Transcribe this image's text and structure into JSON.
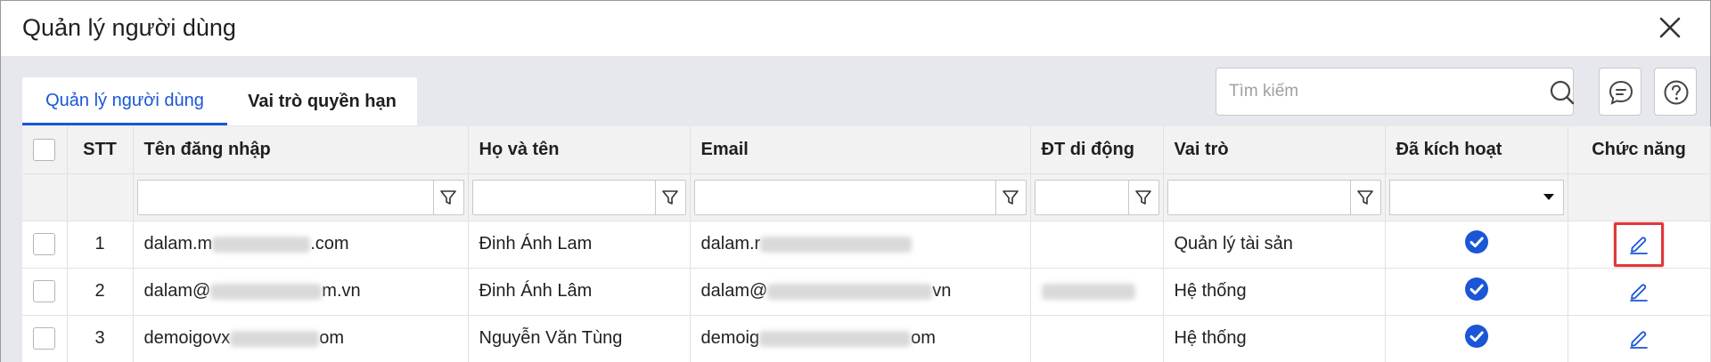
{
  "window": {
    "title": "Quản lý người dùng"
  },
  "tabs": [
    {
      "label": "Quản lý người dùng",
      "active": true
    },
    {
      "label": "Vai trò quyền hạn",
      "active": false
    }
  ],
  "search": {
    "placeholder": "Tìm kiếm"
  },
  "icons": {
    "search": "search-icon",
    "feedback": "chat-bubble-icon",
    "help": "help-circle-icon",
    "close": "close-icon",
    "filter": "filter-funnel-icon",
    "active": "check-circle-icon",
    "edit": "pencil-edit-icon"
  },
  "colors": {
    "accent": "#1a56d6",
    "check": "#1a56d6",
    "highlight": "#e0383b",
    "body_bg": "#e6e8ee"
  },
  "table": {
    "columns": [
      "STT",
      "Tên đăng nhập",
      "Họ và tên",
      "Email",
      "ĐT di động",
      "Vai trò",
      "Đã kích hoạt",
      "Chức năng"
    ],
    "rows": [
      {
        "stt": "1",
        "username_prefix": "dalam.m",
        "username_suffix": ".com",
        "fullname": "Đinh Ánh Lam",
        "email_prefix": "dalam.r",
        "email_suffix": "",
        "phone": "",
        "role": "Quản lý tài sản",
        "active": true
      },
      {
        "stt": "2",
        "username_prefix": "dalam@",
        "username_suffix": "m.vn",
        "fullname": "Đinh Ánh Lâm",
        "email_prefix": "dalam@",
        "email_suffix": "vn",
        "phone": "",
        "role": "Hệ thống",
        "active": true
      },
      {
        "stt": "3",
        "username_prefix": "demoigovx",
        "username_suffix": "om",
        "fullname": "Nguyễn Văn Tùng",
        "email_prefix": "demoig",
        "email_suffix": "om",
        "phone": "",
        "role": "Hệ thống",
        "active": true
      }
    ]
  }
}
